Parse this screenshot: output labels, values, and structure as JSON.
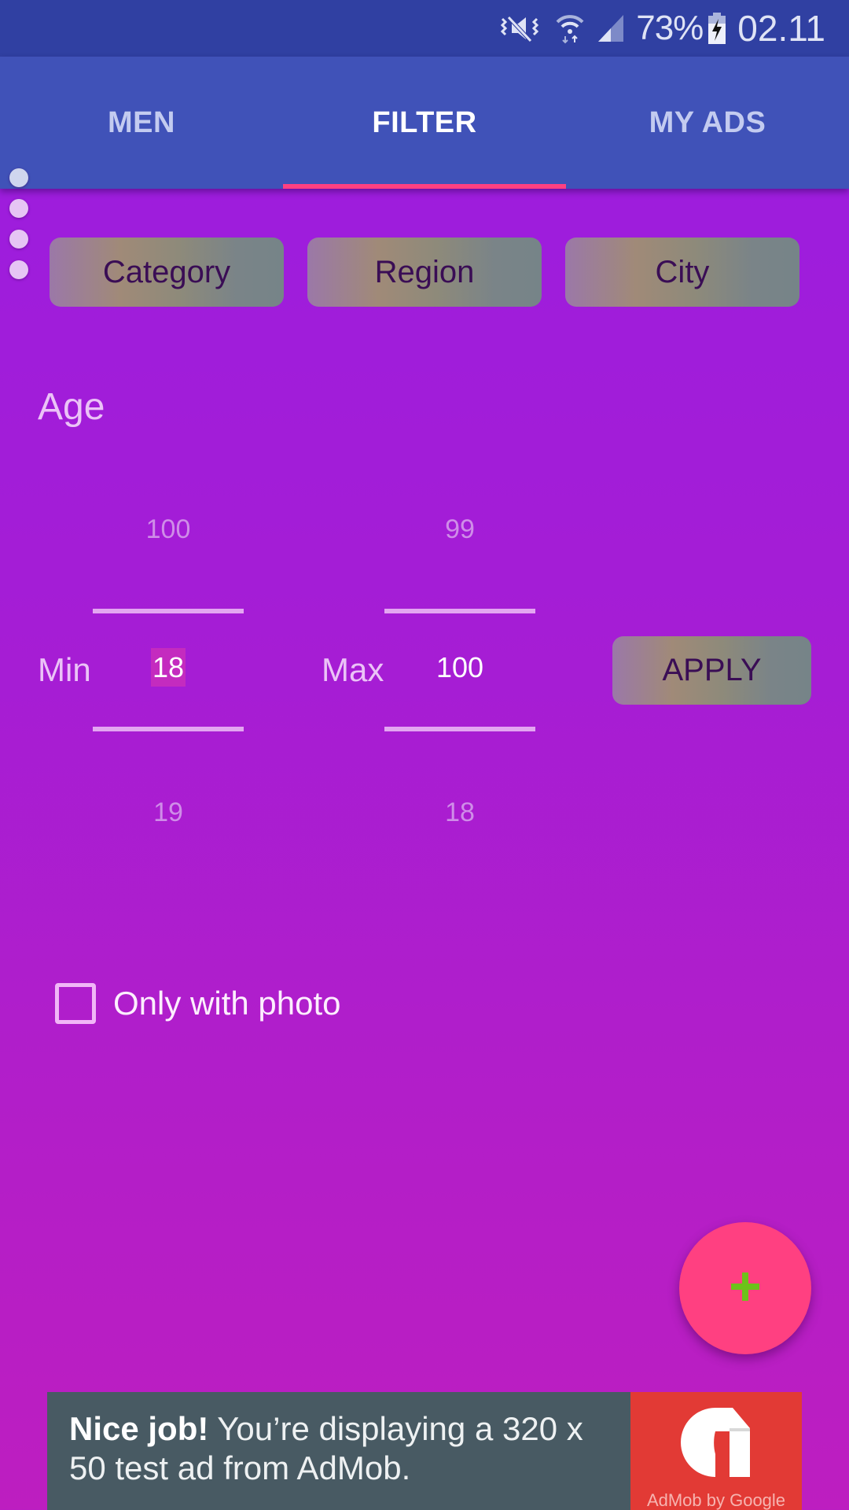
{
  "status_bar": {
    "icons": [
      "vibrate-mute-icon",
      "wifi-icon",
      "signal-icon",
      "battery-charging-icon"
    ],
    "battery_percent": "73%",
    "time": "02.11"
  },
  "tabs": [
    {
      "label": "MEN",
      "active": false
    },
    {
      "label": "FILTER",
      "active": true
    },
    {
      "label": "MY ADS",
      "active": false
    }
  ],
  "accent_color": "#ff4081",
  "page_indicator": {
    "count": 4,
    "current": 1
  },
  "filter_buttons": [
    {
      "label": "Category"
    },
    {
      "label": "Region"
    },
    {
      "label": "City"
    }
  ],
  "age": {
    "label": "Age",
    "min": {
      "label": "Min",
      "prev": "100",
      "value": "18",
      "next": "19"
    },
    "max": {
      "label": "Max",
      "prev": "99",
      "value": "100",
      "next": "18"
    },
    "apply_label": "APPLY"
  },
  "only_with_photo": {
    "label": "Only with photo",
    "checked": false
  },
  "fab": {
    "icon": "plus-icon"
  },
  "ad": {
    "bold": "Nice job!",
    "text": " You’re displaying a 320 x 50 test ad from AdMob.",
    "brand": "AdMob by Google"
  }
}
